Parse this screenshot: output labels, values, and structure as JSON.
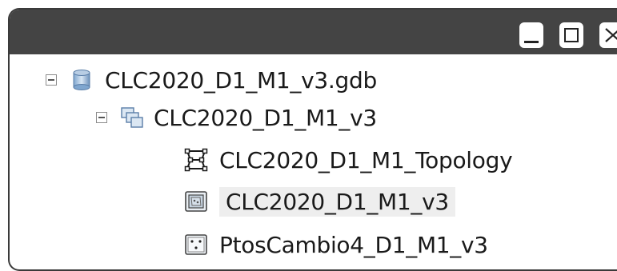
{
  "window": {
    "buttons": {
      "minimize": "minimize",
      "maximize": "maximize",
      "close": "close"
    }
  },
  "tree": {
    "items": [
      {
        "label": "CLC2020_D1_M1_v3.gdb",
        "icon": "geodatabase-icon",
        "expanded": true
      },
      {
        "label": "CLC2020_D1_M1_v3",
        "icon": "feature-dataset-icon",
        "expanded": true
      },
      {
        "label": "CLC2020_D1_M1_Topology",
        "icon": "topology-icon"
      },
      {
        "label": "CLC2020_D1_M1_v3",
        "icon": "polygon-feature-class-icon",
        "selected": true
      },
      {
        "label": "PtosCambio4_D1_M1_v3",
        "icon": "point-feature-class-icon"
      }
    ]
  }
}
